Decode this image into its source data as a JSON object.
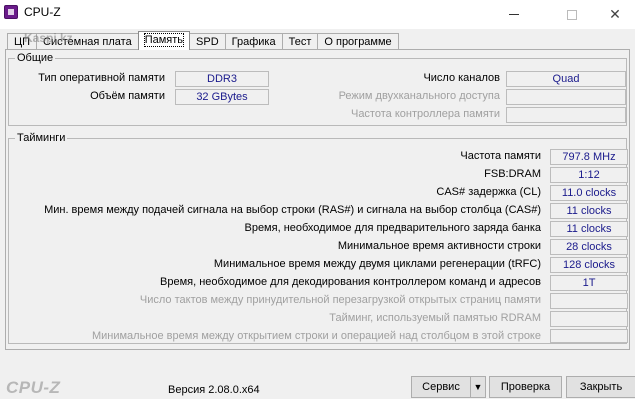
{
  "window": {
    "title": "CPU-Z",
    "minimize": "—",
    "maximize": "☐",
    "close": "✕"
  },
  "watermark": "Kaspi.kz",
  "tabs": [
    "ЦП",
    "Системная плата",
    "Память",
    "SPD",
    "Графика",
    "Тест",
    "О программе"
  ],
  "general": {
    "title": "Общие",
    "type_label": "Тип оперативной памяти",
    "type_value": "DDR3",
    "size_label": "Объём памяти",
    "size_value": "32 GBytes",
    "channels_label": "Число каналов",
    "channels_value": "Quad",
    "dual_label": "Режим двухканального доступа",
    "dual_value": "",
    "nbfreq_label": "Частота контроллера памяти",
    "nbfreq_value": ""
  },
  "timings": {
    "title": "Тайминги",
    "rows": [
      {
        "label": "Частота памяти",
        "value": "797.8 MHz",
        "disabled": false
      },
      {
        "label": "FSB:DRAM",
        "value": "1:12",
        "disabled": false
      },
      {
        "label": "CAS# задержка (CL)",
        "value": "11.0 clocks",
        "disabled": false
      },
      {
        "label": "Мин. время между подачей сигнала на выбор строки (RAS#) и сигнала на выбор столбца (CAS#)",
        "value": "11 clocks",
        "disabled": false
      },
      {
        "label": "Время, необходимое для предварительного заряда банка",
        "value": "11 clocks",
        "disabled": false
      },
      {
        "label": "Минимальное время активности строки",
        "value": "28 clocks",
        "disabled": false
      },
      {
        "label": "Минимальное время между двумя циклами регенерации (tRFC)",
        "value": "128 clocks",
        "disabled": false
      },
      {
        "label": "Время, необходимое для декодирования контроллером команд и адресов",
        "value": "1T",
        "disabled": false
      },
      {
        "label": "Число тактов между принудительной перезагрузкой открытых страниц памяти",
        "value": "",
        "disabled": true
      },
      {
        "label": "Тайминг, используемый памятью RDRAM",
        "value": "",
        "disabled": true
      },
      {
        "label": "Минимальное время между открытием строки и операцией над столбцом в этой строке",
        "value": "",
        "disabled": true
      }
    ]
  },
  "footer": {
    "logo": "CPU-Z",
    "version": "Версия 2.08.0.x64",
    "service_label": "Сервис",
    "validate_label": "Проверка",
    "close_label": "Закрыть"
  }
}
